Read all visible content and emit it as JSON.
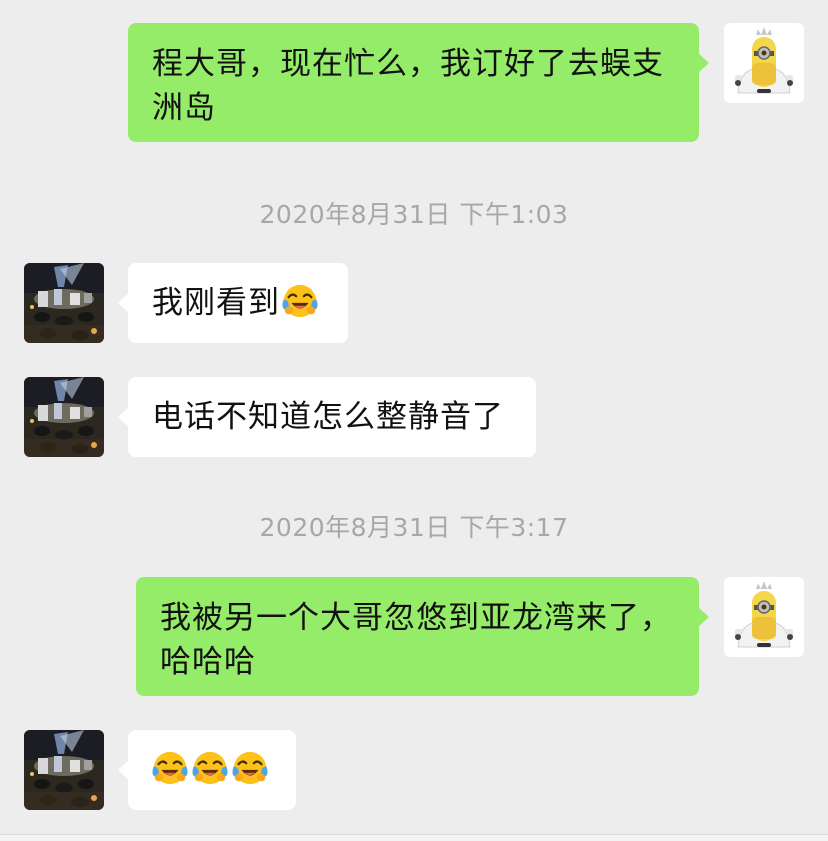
{
  "messages": {
    "m1": {
      "sender": "self",
      "text_line1": "程大哥，现在忙么，我订好了去蜈支",
      "text_line2": "洲岛"
    },
    "t1": {
      "text": "2020年8月31日 下午1:03"
    },
    "m2": {
      "sender": "other",
      "text": "我刚看到",
      "emoji": [
        "face-with-tears-of-joy"
      ]
    },
    "m3": {
      "sender": "other",
      "text": "电话不知道怎么整静音了"
    },
    "t2": {
      "text": "2020年8月31日 下午3:17"
    },
    "m4": {
      "sender": "self",
      "text_line1": "我被另一个大哥忽悠到亚龙湾来了，",
      "text_line2": "哈哈哈"
    },
    "m5": {
      "sender": "other",
      "emoji": [
        "face-with-tears-of-joy",
        "face-with-tears-of-joy",
        "face-with-tears-of-joy"
      ]
    }
  },
  "colors": {
    "background": "#ededed",
    "self_bubble": "#95ec69",
    "other_bubble": "#ffffff",
    "timestamp": "#a7a7a7"
  },
  "icons": {
    "self_avatar": "minion-avatar",
    "other_avatar": "night-photo-avatar",
    "emoji": "face-with-tears-of-joy"
  }
}
